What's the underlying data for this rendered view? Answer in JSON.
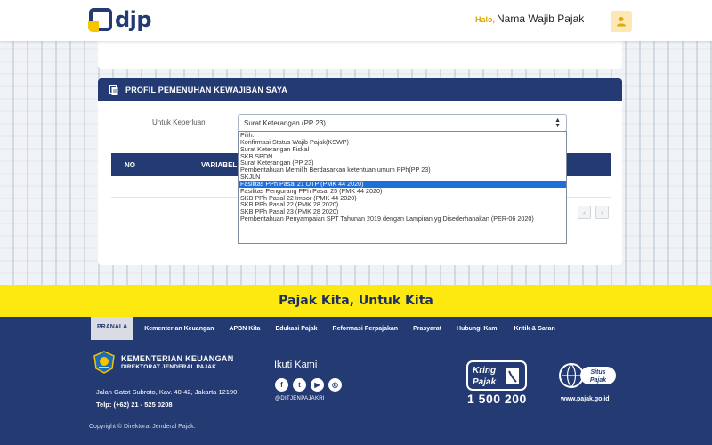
{
  "header": {
    "logo_text": "djp",
    "greeting": "Halo,",
    "user_name": "Nama Wajib Pajak",
    "icon": "user-icon"
  },
  "panel": {
    "title": "PROFIL PEMENUHAN KEWAJIBAN SAYA",
    "label": "Untuk Keperluan",
    "selected_value": "Surat Keterangan (PP 23)",
    "table_headers": [
      "NO",
      "VARIABEL"
    ],
    "dropdown_options": [
      "Pilih..",
      "Konfirmasi Status Wajib Pajak(KSWP)",
      "Surat Keterangan Fiskal",
      "SKB SPDN",
      "Surat Keterangan (PP 23)",
      "Pemberitahuan Memilih Berdasarkan ketentuan umum PPh(PP 23)",
      "SKJLN",
      "Fasilitas PPh Pasal 21 DTP (PMK 44 2020)",
      "Fasilitas Pengurang PPh Pasal 25 (PMK 44 2020)",
      "SKB PPh Pasal 22 Impor (PMK 44 2020)",
      "SKB PPh Pasal 22 (PMK 28 2020)",
      "SKB PPh Pasal 23 (PMK 28 2020)",
      "Pemberitahuan Penyampaian SPT Tahunan 2019 dengan Lampiran yg Disederhanakan (PER-06 2020)"
    ],
    "highlighted_index": 7
  },
  "banner": {
    "text": "Pajak Kita, Untuk Kita"
  },
  "footer": {
    "nav": [
      "PRANALA",
      "Kementerian Keuangan",
      "APBN Kita",
      "Edukasi Pajak",
      "Reformasi Perpajakan",
      "Prasyarat",
      "Hubungi Kami",
      "Kritik & Saran"
    ],
    "org_name": "KEMENTERIAN KEUANGAN",
    "org_sub": "DIREKTORAT JENDERAL PAJAK",
    "address": "Jalan Gatot Subroto, Kav. 40-42, Jakarta 12190",
    "phone": "Telp: (+62) 21 - 525 0208",
    "copyright": "Copyright ©  Direktorat Jenderal Pajak.",
    "follow_title": "Ikuti Kami",
    "social_icons": [
      "facebook-icon",
      "twitter-icon",
      "youtube-icon",
      "instagram-icon"
    ],
    "social_handle": "@DITJENPAJAKRI",
    "kring_line1": "Kring",
    "kring_line2": "Pajak",
    "kring_number": "1 500 200",
    "situs_line1": "Situs",
    "situs_line2": "Pajak",
    "situs_url": "www.pajak.go.id"
  },
  "colors": {
    "primary": "#233a73",
    "accent": "#fde910",
    "highlight": "#1e6fd9"
  }
}
